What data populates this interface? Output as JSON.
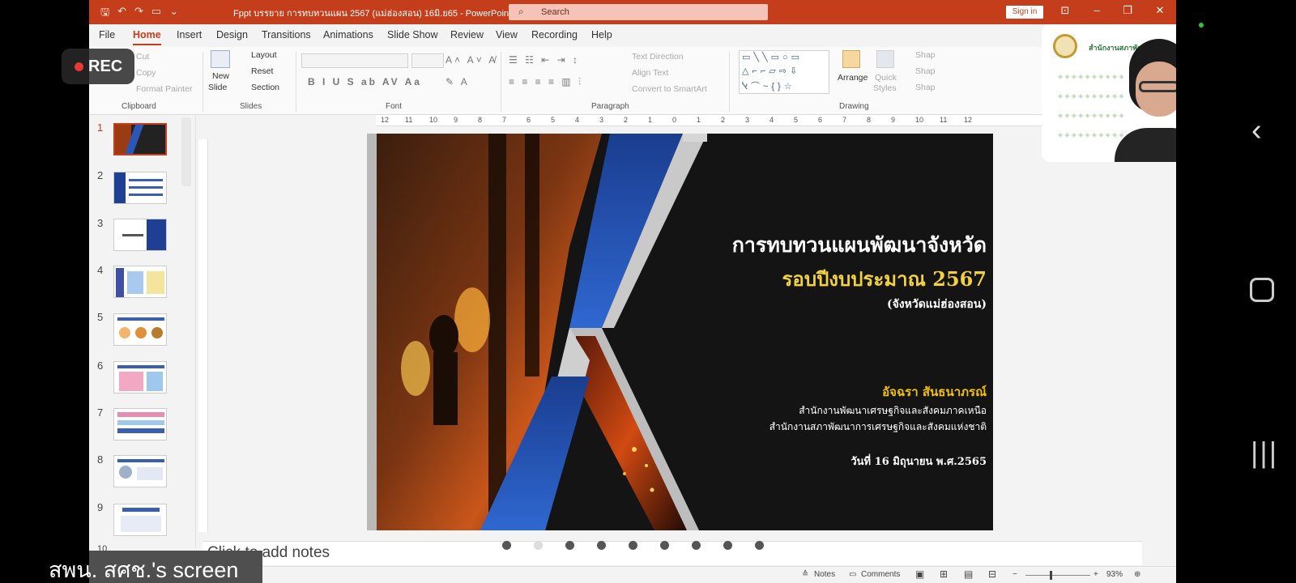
{
  "title_bar": {
    "document_title": "Fppt บรรยาย การทบทวนแผน 2567 (แม่ฮ่องสอน) 16มิ.ย65  -  PowerPoint",
    "search_placeholder": "Search",
    "sign_in": "Sign in"
  },
  "ribbon": {
    "tabs": [
      "File",
      "Home",
      "Insert",
      "Design",
      "Transitions",
      "Animations",
      "Slide Show",
      "Review",
      "View",
      "Recording",
      "Help"
    ],
    "active_tab": "Home",
    "clipboard": {
      "cut": "Cut",
      "copy": "Copy",
      "format_painter": "Format Painter",
      "label": "Clipboard"
    },
    "slides": {
      "new_slide": "New",
      "new_slide_2": "Slide",
      "layout": "Layout",
      "reset": "Reset",
      "section": "Section",
      "label": "Slides"
    },
    "font_label": "Font",
    "paragraph": {
      "text_direction": "Text Direction",
      "align_text": "Align Text",
      "convert_smartart": "Convert to SmartArt",
      "label": "Paragraph"
    },
    "drawing": {
      "arrange": "Arrange",
      "quick_styles": "Quick",
      "quick_styles_2": "Styles",
      "shape": "Shap",
      "label": "Drawing"
    }
  },
  "thumbnails": [
    "1",
    "2",
    "3",
    "4",
    "5",
    "6",
    "7",
    "8",
    "9",
    "10"
  ],
  "slide": {
    "title": "การทบทวนแผนพัฒนาจังหวัด",
    "subtitle": "รอบปีงบประมาณ 2567",
    "province": "(จังหวัดแม่ฮ่องสอน)",
    "presenter": "อัจฉรา สันธนาภรณ์",
    "org1": "สำนักงานพัฒนาเศรษฐกิจและสังคมภาคเหนือ",
    "org2": "สำนักงานสภาพัฒนาการเศรษฐกิจและสังคมแห่งชาติ",
    "date": "วันที่ 16 มิถุนายน พ.ศ.2565",
    "colors": {
      "title": "#ffffff",
      "subtitle": "#f2d23c",
      "presenter": "#f2c200",
      "blue": "#1f4fa8"
    }
  },
  "notes_placeholder": "Click to add notes",
  "status_bar": {
    "notes": "Notes",
    "comments": "Comments",
    "zoom": "93%"
  },
  "webcam": {
    "org_text": "สำนักงานสภาพัฒนาการเศรษฐกิจและสังคมแห่งชาติ"
  },
  "recording": {
    "label": "REC"
  },
  "screen_share": {
    "label": "สพน. สศช.'s screen"
  }
}
